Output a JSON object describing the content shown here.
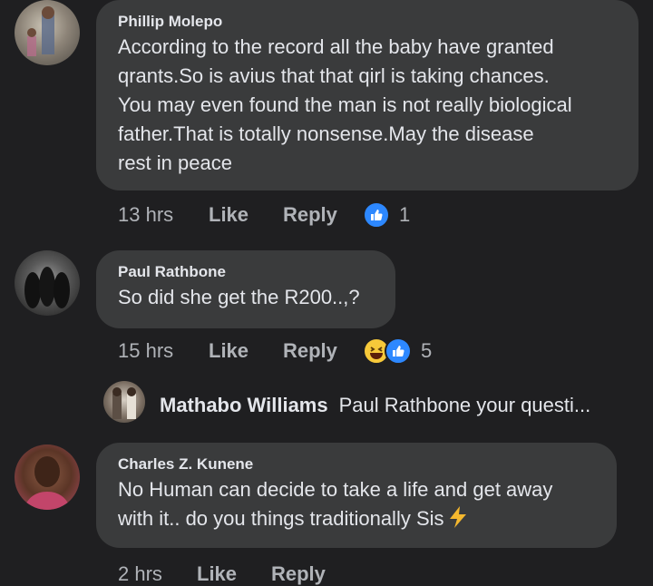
{
  "comments": [
    {
      "author": "Phillip Molepo",
      "lines": [
        "According to the record all the baby have granted",
        "qrants.So is avius that that qirl is taking chances.",
        "You may even found the man is not really biological",
        "father.That is totally nonsense.May the disease",
        "rest in peace"
      ],
      "time": "13 hrs",
      "like_label": "Like",
      "reply_label": "Reply",
      "reaction_count": "1",
      "reactions": [
        "like-icon"
      ]
    },
    {
      "author": "Paul Rathbone",
      "lines": [
        "So did she get the R200..,?"
      ],
      "time": "15 hrs",
      "like_label": "Like",
      "reply_label": "Reply",
      "reaction_count": "5",
      "reactions": [
        "haha-icon",
        "like-icon"
      ],
      "reply_preview": {
        "author": "Mathabo Williams",
        "text": "Paul Rathbone your questi..."
      }
    },
    {
      "author": "Charles Z. Kunene",
      "lines": [
        "No Human can decide to take a life and get away",
        "with it.. do you things traditionally Sis"
      ],
      "emoji": "lightning-icon",
      "time": "2 hrs",
      "like_label": "Like",
      "reply_label": "Reply"
    }
  ],
  "colors": {
    "background": "#1f1f21",
    "bubble": "#3a3b3c",
    "text": "#e4e6eb",
    "muted": "#b0b3b8",
    "like_blue": "#2d88ff"
  }
}
